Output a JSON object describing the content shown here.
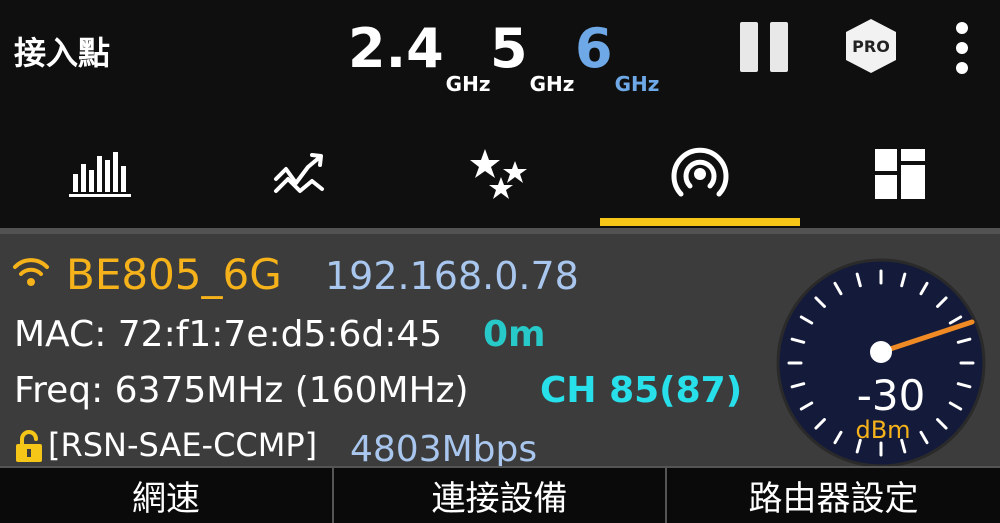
{
  "header": {
    "title": "接入點",
    "bands": [
      {
        "value": "2.4",
        "unit": "GHz",
        "selected": false
      },
      {
        "value": "5",
        "unit": "GHz",
        "selected": false
      },
      {
        "value": "6",
        "unit": "GHz",
        "selected": true
      }
    ],
    "pro_label": "PRO"
  },
  "tabs": [
    {
      "icon": "bar-chart-icon",
      "active": false
    },
    {
      "icon": "trend-chart-icon",
      "active": false
    },
    {
      "icon": "stars-icon",
      "active": false
    },
    {
      "icon": "access-point-icon",
      "active": true
    },
    {
      "icon": "dashboard-icon",
      "active": false
    }
  ],
  "ap": {
    "ssid": "BE805_6G",
    "ip": "192.168.0.78",
    "mac": "MAC: 72:f1:7e:d5:6d:45",
    "distance": "0m",
    "freq": "Freq: 6375MHz  (160MHz)",
    "channel": "CH 85(87)",
    "security": "[RSN-SAE-CCMP]",
    "rate": "4803Mbps"
  },
  "gauge": {
    "value": "-30",
    "unit": "dBm"
  },
  "bottom_buttons": [
    "網速",
    "連接設備",
    "路由器設定"
  ],
  "colors": {
    "accent": "#f5c518",
    "ssid": "#f5b21a",
    "selected_band": "#6ea8e6",
    "channel": "#27e0ea",
    "needle": "#f08a24"
  }
}
